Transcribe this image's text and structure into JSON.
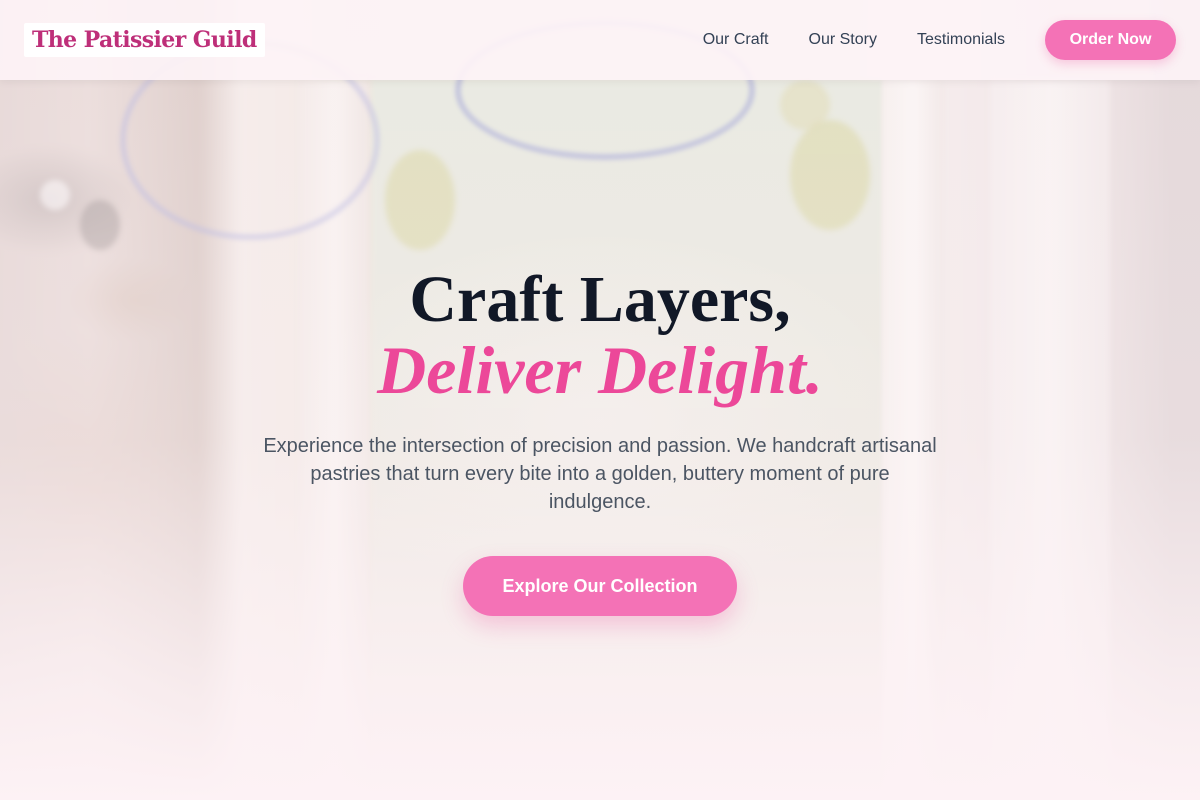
{
  "brand": {
    "name": "The Patissier Guild"
  },
  "nav": {
    "links": [
      "Our Craft",
      "Our Story",
      "Testimonials"
    ],
    "order_button": "Order Now"
  },
  "hero": {
    "headline_line1": "Craft Layers,",
    "headline_line2": "Deliver Delight.",
    "description": "Experience the intersection of precision and passion. We handcraft artisanal pastries that turn every bite into a golden, buttery moment of pure indulgence.",
    "cta_button": "Explore Our Collection"
  },
  "colors": {
    "brand_pink": "#be2f79",
    "accent_pink": "#ec4899",
    "button_pink": "#f472b6",
    "heading_dark": "#111827",
    "body_gray": "#4b5563",
    "page_background": "#fdf2f5"
  }
}
